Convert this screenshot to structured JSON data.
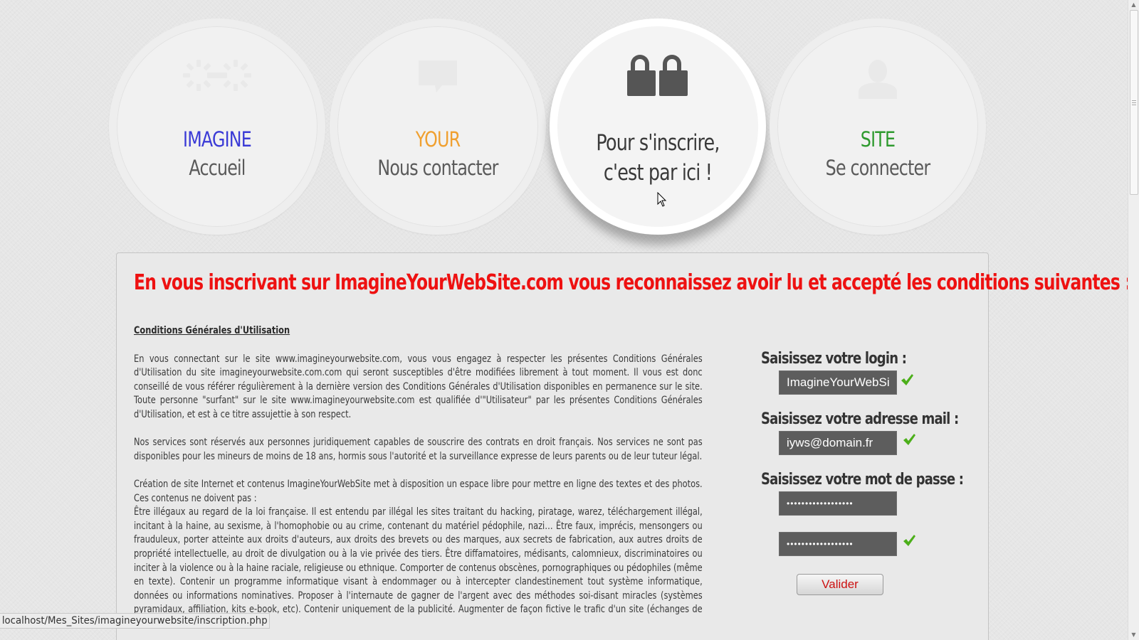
{
  "nav": {
    "items": [
      {
        "brand": "IMAGINE",
        "label": "Accueil",
        "icon": "gears-icon",
        "brand_color": "#3b3bd6"
      },
      {
        "brand": "YOUR",
        "label": "Nous contacter",
        "icon": "chat-bubble-icon",
        "brand_color": "#f0a030"
      },
      {
        "label_line1": "Pour s'inscrire,",
        "label_line2": "c'est par ici !",
        "icon": "padlocks-icon"
      },
      {
        "brand": "SITE",
        "label": "Se connecter",
        "icon": "user-icon",
        "brand_color": "#2e9a2e"
      }
    ]
  },
  "panel": {
    "title": "En vous inscrivant sur ImagineYourWebSite.com vous reconnaissez avoir lu et accepté les conditions suivantes :",
    "title_color": "#ee1111",
    "terms": {
      "heading": "Conditions Générales d'Utilisation",
      "p1": "En vous connectant sur le site www.imagineyourwebsite.com, vous vous engagez à respecter les présentes Conditions Générales d'Utilisation du site imagineyourwebsite.com.com qui seront susceptibles d'être modifiées librement à tout moment. Il vous est donc conseillé de vous référer régulièrement à la dernière version des Conditions Générales d'Utilisation disponibles en permanence sur le site. Toute personne \"surfant\" sur le site www.imagineyourwebsite.com est qualifiée d'\"Utilisateur\" par les présentes Conditions Générales d'Utilisation, et est à ce titre assujettie à son respect.",
      "p2": "Nos services sont réservés aux personnes juridiquement capables de souscrire des contrats en droit français. Nos services ne sont pas disponibles pour les mineurs de moins de 18 ans, hormis sous l'autorité et la surveillance expresse de leurs parents ou de leur tuteur légal.",
      "p3": "Création de site Internet et contenus ImagineYourWebSite met à disposition un espace libre pour mettre en ligne des textes et des photos. Ces contenus ne doivent pas :",
      "p4": "Être illégaux au regard de la loi française. Il est entendu par illégal les sites traitant du hacking, piratage, warez, téléchargement illégal, incitant à la haine, au sexisme, à l'homophobie ou au crime, contenant du matériel pédophile, nazi… Être faux, imprécis, mensongers ou frauduleux, porter atteinte aux droits d'auteurs, aux droits des brevets ou des marques, aux secrets de fabrication, aux autres droits de propriété intellectuelle, au droit de divulgation ou à la vie privée des tiers. Être diffamatoires, médisants, calomnieux, discriminatoires ou inciter à la violence ou à la haine raciale, religieuse ou ethnique. Comporter de contenus obscènes, pornographiques ou pédophiles (même en texte). Contenir un programme informatique visant à endommager ou à intercepter clandestinement tout système informatique, données ou informations nominatives. Proposer à l'internaute de gagner de l'argent avec des méthodes soi-disant miracles (systèmes pyramidaux, affiliation, kits e-book, etc). Contenir uniquement de la publicité. Augmenter de façon fictive le trafic d'un site (échanges de surf, etc)."
    }
  },
  "form": {
    "login_label": "Saisissez votre login :",
    "login_value": "ImagineYourWebSite",
    "email_label": "Saisissez votre adresse mail :",
    "email_value": "iyws@domain.fr",
    "password_label": "Saisissez votre mot de passe :",
    "password_value": "••••••••••••••••••",
    "password_confirm_value": "••••••••••••••••••",
    "submit_label": "Valider",
    "check_icon": "check-icon",
    "check_color": "#4caf1a"
  },
  "status_bar": {
    "url": "localhost/Mes_Sites/imagineyourwebsite/inscription.php"
  }
}
